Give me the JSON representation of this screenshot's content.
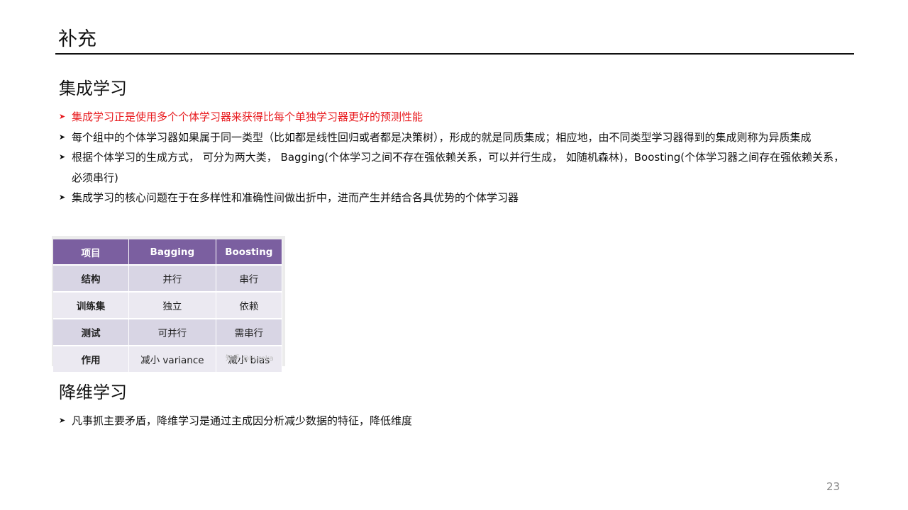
{
  "title": "补充",
  "sections": [
    {
      "heading": "集成学习",
      "bullets": [
        {
          "text": "集成学习正是使用多个个体学习器来获得比每个单独学习器更好的预测性能",
          "color": "#e8191d"
        },
        {
          "text": "每个组中的个体学习器如果属于同一类型（比如都是线性回归或者都是决策树），形成的就是同质集成；相应地，由不同类型学习器得到的集成则称为异质集成"
        },
        {
          "text": "根据个体学习的生成方式， 可分为两大类， Bagging(个体学习之间不存在强依赖关系，可以并行生成， 如随机森林)，Boosting(个体学习器之间存在强依赖关系，必须串行)"
        },
        {
          "text": "集成学习的核心问题在于在多样性和准确性间做出折中，进而产生并结合各具优势的个体学习器"
        }
      ]
    },
    {
      "heading": "降维学习",
      "bullets": [
        {
          "text": "凡事抓主要矛盾，降维学习是通过主成因分析减少数据的特征，降低维度"
        }
      ]
    }
  ],
  "table": {
    "headers": [
      "项目",
      "Bagging",
      "Boosting"
    ],
    "rows": [
      [
        "结构",
        "并行",
        "串行"
      ],
      [
        "训练集",
        "独立",
        "依赖"
      ],
      [
        "测试",
        "可并行",
        "需串行"
      ],
      [
        "作用",
        "减小 variance",
        "减小 bias"
      ]
    ],
    "header_color": "#7b5fa0",
    "watermark": "知乎 @Eureka"
  },
  "page_number": "23",
  "bullet_symbol": "➤"
}
